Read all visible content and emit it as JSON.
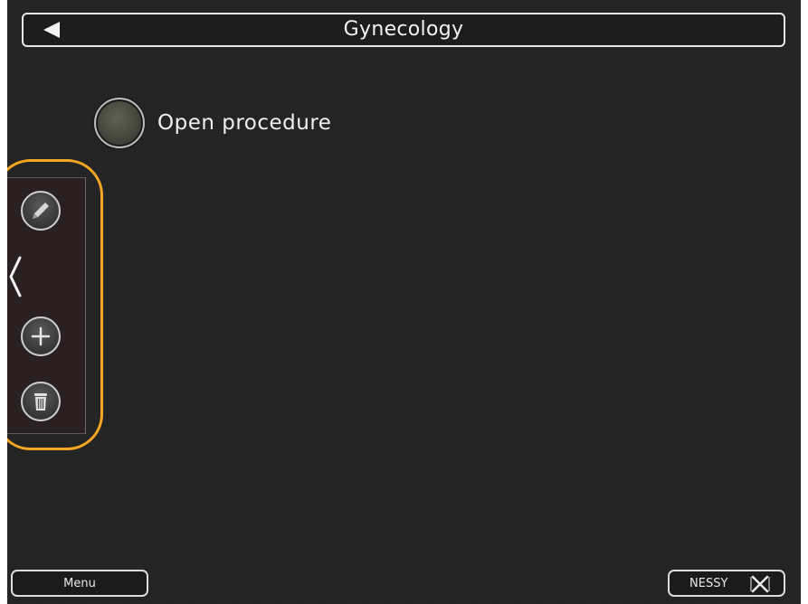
{
  "header": {
    "title": "Gynecology",
    "back_icon": "triangle-left-icon"
  },
  "main": {
    "procedure_label": "Open procedure",
    "procedure_radio_color": "#4a4c3f"
  },
  "side_panel": {
    "collapse_icon": "chevron-left-icon",
    "actions": [
      "pencil-icon",
      "plus-icon",
      "trash-icon"
    ],
    "highlight_color": "#f5a623"
  },
  "footer": {
    "menu_label": "Menu",
    "nessy_label": "NESSY",
    "nessy_icon": "x-icon"
  }
}
